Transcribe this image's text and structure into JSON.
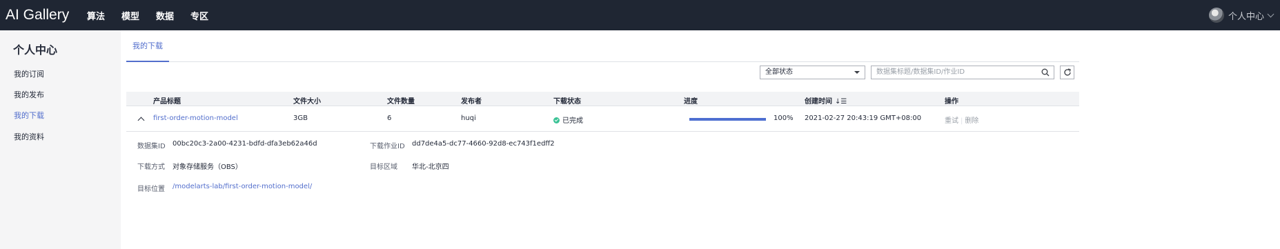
{
  "app": {
    "brand": "AI Gallery"
  },
  "nav": {
    "items": [
      "算法",
      "模型",
      "数据",
      "专区"
    ]
  },
  "user": {
    "label": "个人中心"
  },
  "sidebar": {
    "title": "个人中心",
    "items": [
      "我的订阅",
      "我的发布",
      "我的下载",
      "我的资料"
    ],
    "active": "我的下载"
  },
  "tabs": [
    "我的下载"
  ],
  "filters": {
    "status_value": "全部状态",
    "search_placeholder": "数据集标题/数据集ID/作业ID"
  },
  "table": {
    "columns": [
      "产品标题",
      "文件大小",
      "文件数量",
      "发布者",
      "下载状态",
      "进度",
      "创建时间",
      "操作"
    ],
    "rows": [
      {
        "title": "first-order-motion-model",
        "size": "3GB",
        "count": "6",
        "publisher": "huqi",
        "status": "已完成",
        "progress": 100,
        "progress_label": "100%",
        "created": "2021-02-27 20:43:19 GMT+08:00",
        "actions": [
          "重试",
          "删除"
        ]
      }
    ]
  },
  "detail": {
    "dataset_id_label": "数据集ID",
    "dataset_id": "00bc20c3-2a00-4231-bdfd-dfa3eb62a46d",
    "job_id_label": "下载作业ID",
    "job_id": "dd7de4a5-dc77-4660-92d8-ec743f1edff2",
    "method_label": "下载方式",
    "method": "对象存储服务（OBS）",
    "region_label": "目标区域",
    "region": "华北-北京四",
    "location_label": "目标位置",
    "location": "/modelarts-lab/first-order-motion-model/"
  },
  "colors": {
    "topbar": "#1f2633",
    "accent": "#526ecc",
    "success": "#3ac295"
  }
}
